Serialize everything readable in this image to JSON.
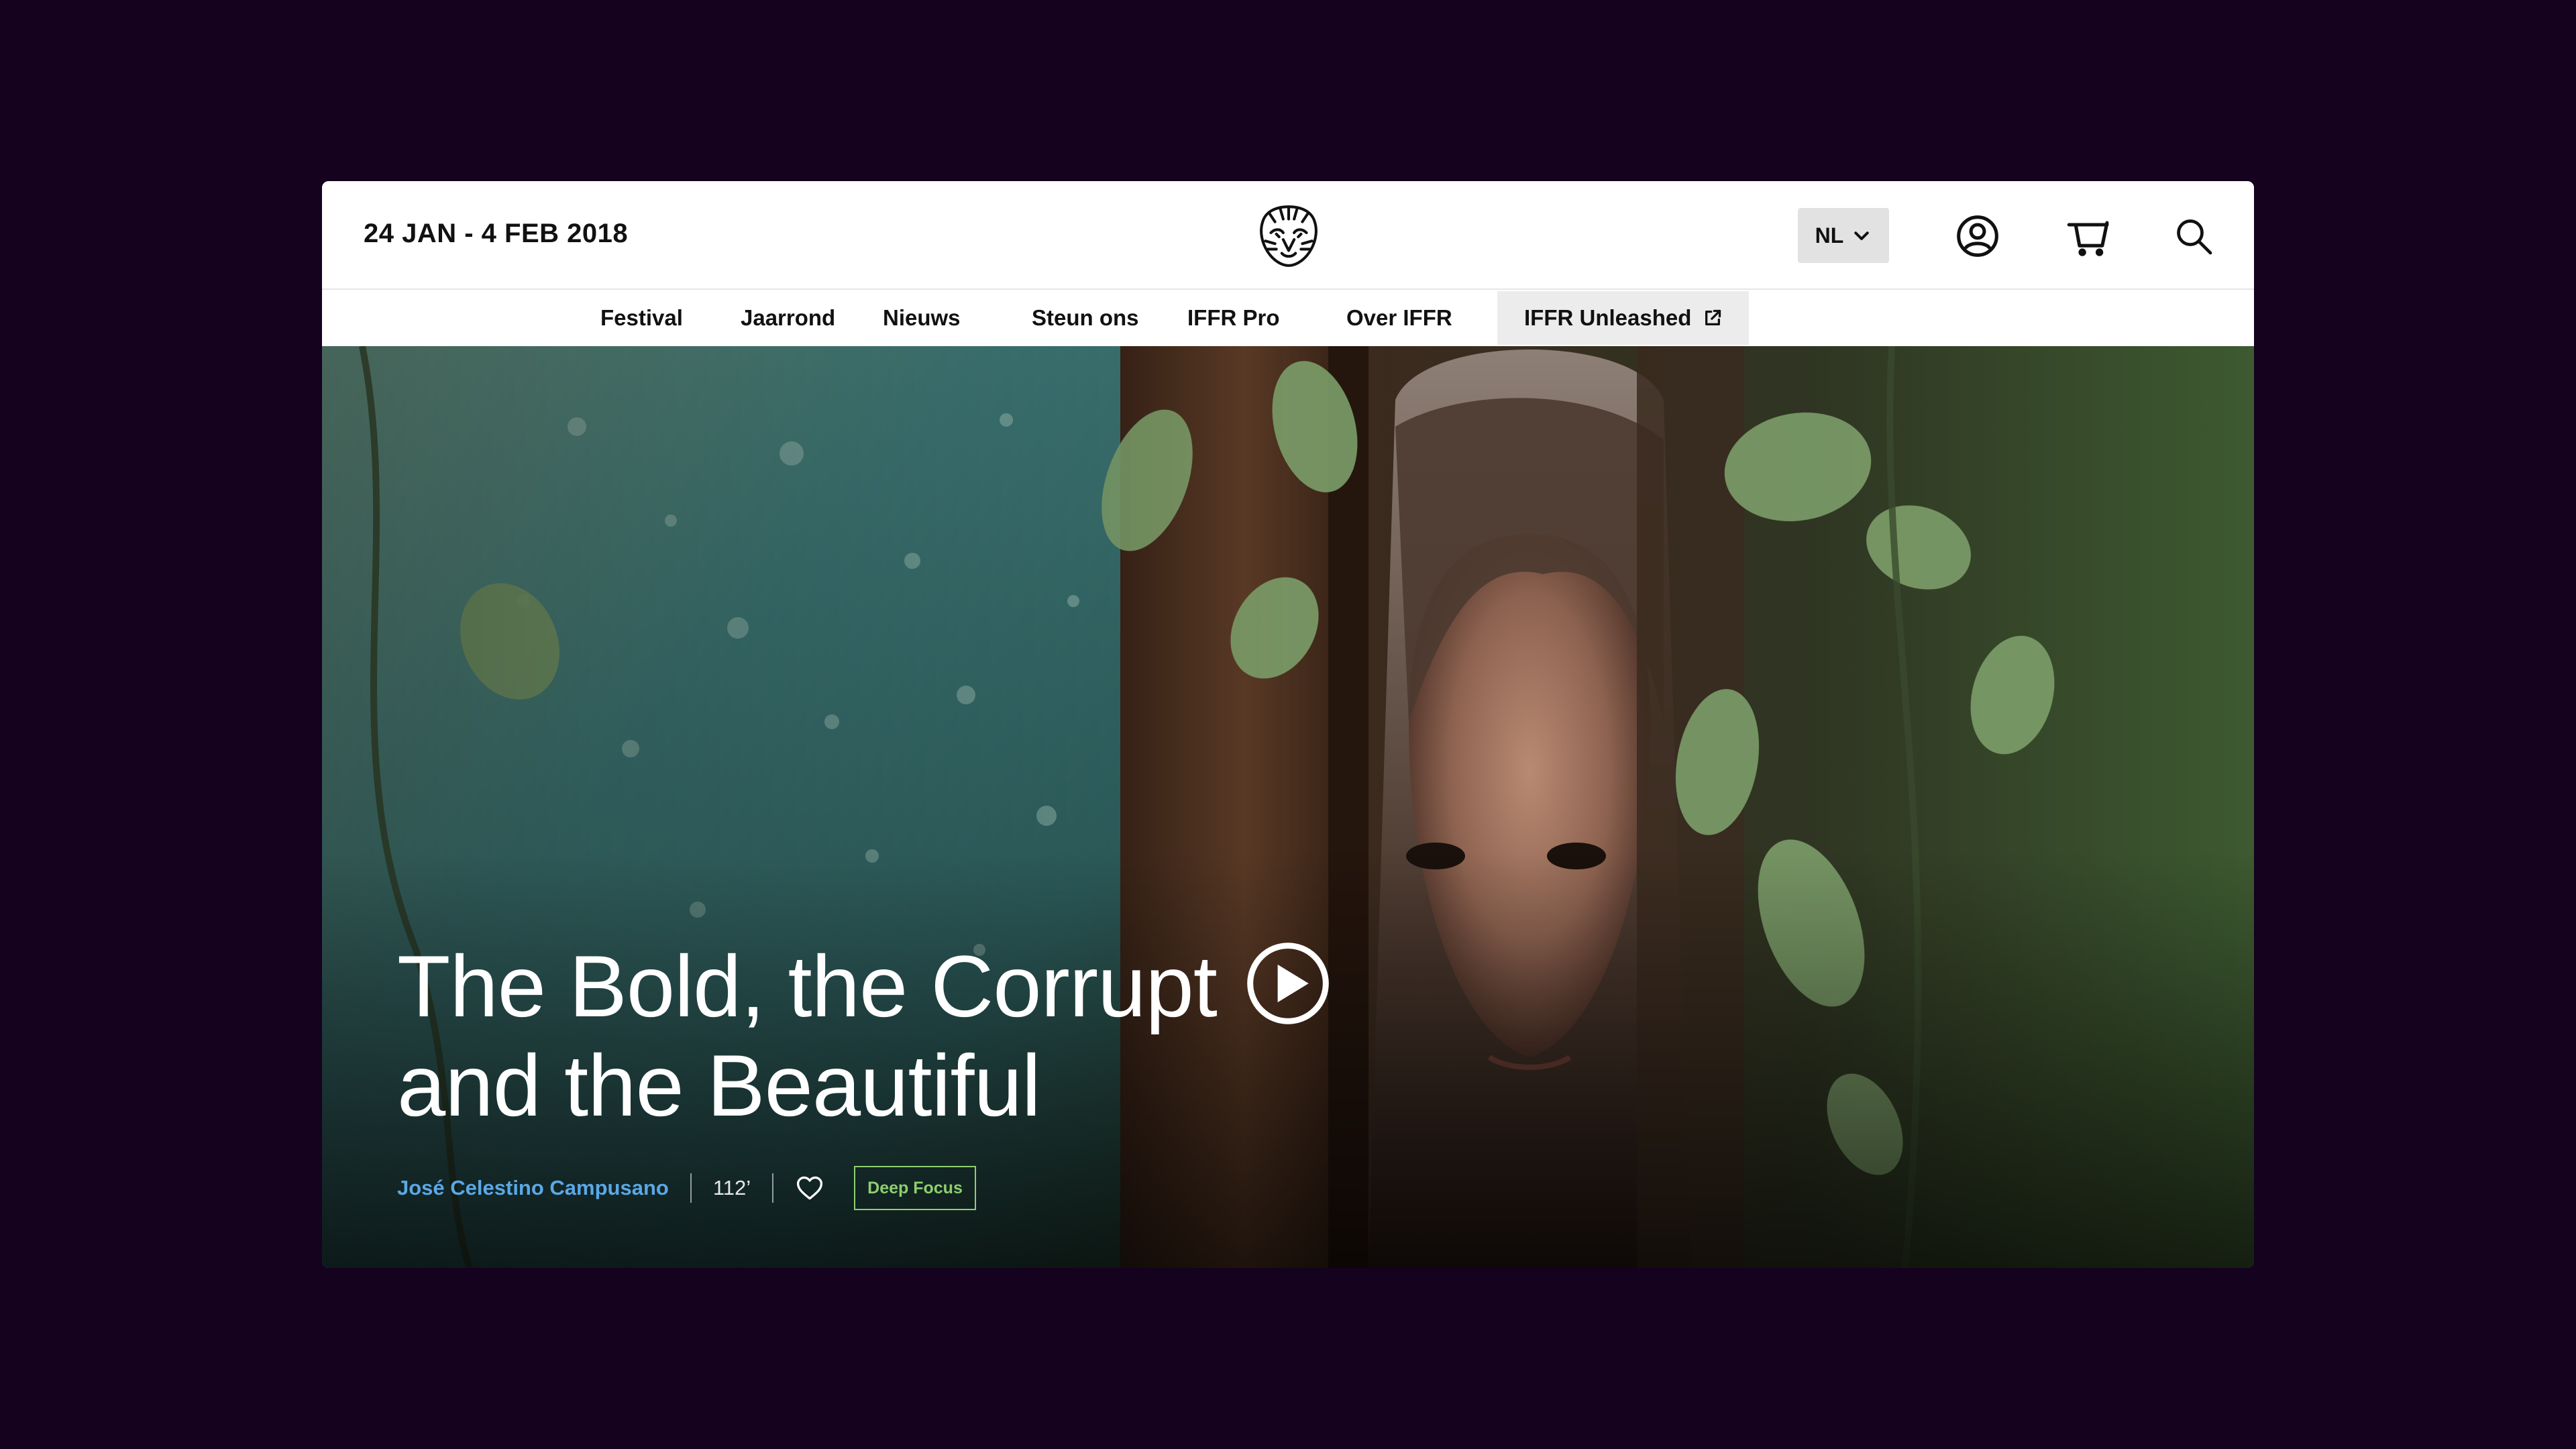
{
  "header": {
    "date_range": "24 JAN - 4 FEB 2018",
    "language": "NL"
  },
  "nav": {
    "items": [
      {
        "label": "Festival"
      },
      {
        "label": "Jaarrond"
      },
      {
        "label": "Nieuws"
      },
      {
        "label": "Steun ons"
      },
      {
        "label": "IFFR Pro"
      },
      {
        "label": "Over IFFR"
      },
      {
        "label": "IFFR Unleashed"
      }
    ]
  },
  "hero": {
    "title_line1": "The Bold, the Corrupt",
    "title_line2": "and the Beautiful",
    "director": "José Celestino Campusano",
    "duration": "112’",
    "tag": "Deep Focus"
  },
  "colors": {
    "page_background": "#14021f",
    "director_link": "#5aa8e6",
    "tag_accent": "#8ecf6e"
  },
  "icons": [
    "tiger-logo-icon",
    "chevron-down-icon",
    "account-icon",
    "cart-icon",
    "search-icon",
    "external-link-icon",
    "play-icon",
    "heart-icon"
  ]
}
